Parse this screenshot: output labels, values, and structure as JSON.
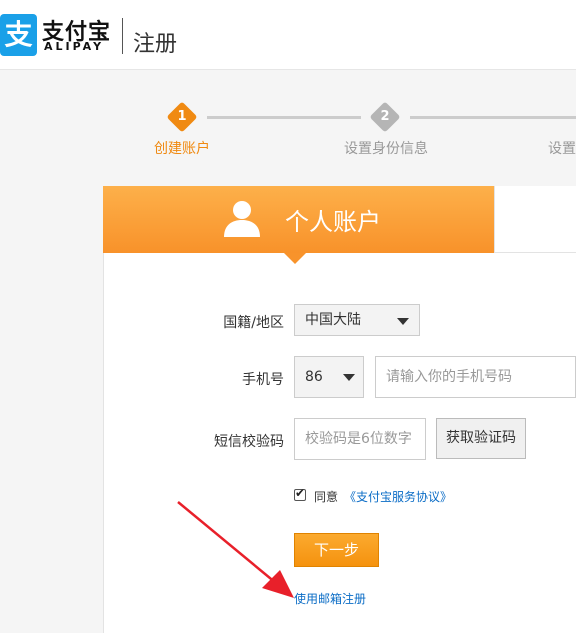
{
  "header": {
    "logo_glyph": "支",
    "logo_cn": "支付宝",
    "logo_en": "ALIPAY",
    "title": "注册"
  },
  "steps": [
    {
      "number": "1",
      "label": "创建账户",
      "active": true
    },
    {
      "number": "2",
      "label": "设置身份信息",
      "active": false
    },
    {
      "number": "",
      "label": "设置",
      "active": false
    }
  ],
  "tabs": {
    "personal": "个人账户"
  },
  "form": {
    "region_label": "国籍/地区",
    "region_value": "中国大陆",
    "phone_label": "手机号",
    "country_code": "86",
    "phone_placeholder": "请输入你的手机号码",
    "sms_label": "短信校验码",
    "sms_placeholder": "校验码是6位数字",
    "get_code_button": "获取验证码",
    "agree_text": "同意",
    "agreement_link": "《支付宝服务协议》",
    "agree_checked": true,
    "next_button": "下一步",
    "email_register_link": "使用邮箱注册"
  },
  "colors": {
    "brand_blue": "#1aa0e8",
    "accent_orange": "#f8922a",
    "link_blue": "#0a6cc6",
    "annotation_red": "#e8202a"
  }
}
